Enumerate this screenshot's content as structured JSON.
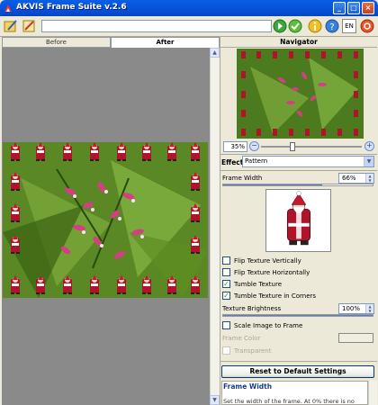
{
  "app": {
    "title": "AKVIS Frame Suite v.2.6"
  },
  "toolbar": {
    "path_value": "",
    "language": "EN"
  },
  "tabs": [
    {
      "label": "Before"
    },
    {
      "label": "After"
    }
  ],
  "navigator": {
    "title": "Navigator",
    "zoom": "35%",
    "zoom_fraction": 0.35
  },
  "effect": {
    "label": "Effect",
    "value": "Pattern"
  },
  "frame_width": {
    "label": "Frame Width",
    "value": "66%",
    "fraction": 0.66
  },
  "options": [
    {
      "label": "Flip Texture Vertically",
      "checked": false
    },
    {
      "label": "Flip Texture Horizontally",
      "checked": false
    },
    {
      "label": "Tumble Texture",
      "checked": true
    },
    {
      "label": "Tumble Texture in Corners",
      "checked": true
    }
  ],
  "texture_brightness": {
    "label": "Texture Brightness",
    "value": "100%",
    "fraction": 1.0
  },
  "scale_image": {
    "label": "Scale Image to Frame",
    "checked": false
  },
  "frame_color": {
    "label": "Frame Color"
  },
  "transparent": {
    "label": "Transparent",
    "checked": false
  },
  "reset": {
    "label": "Reset to Default Settings"
  },
  "help": {
    "title": "Frame Width",
    "text": "Set the width of the frame. At 0% there is no"
  },
  "colors": {
    "titlebar": "#0a5ee6",
    "leaf_green": "#5a8a2a",
    "flower_pink": "#c8387a",
    "canvas_gray": "#8a8a8a"
  }
}
